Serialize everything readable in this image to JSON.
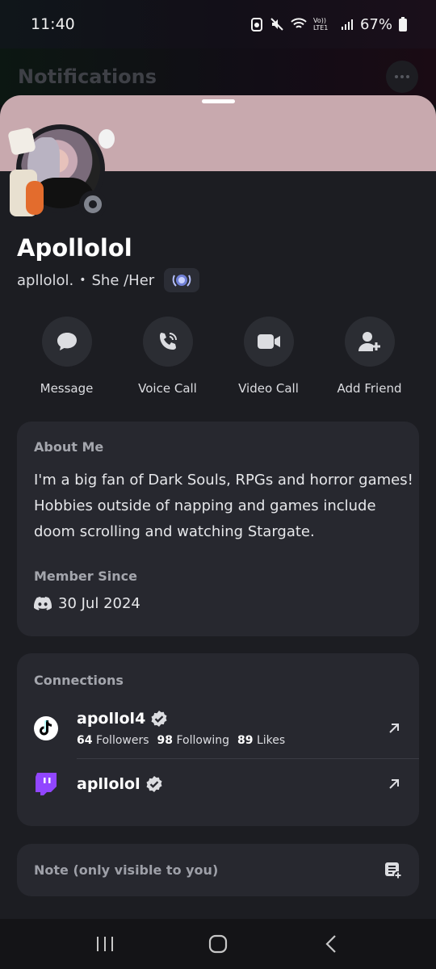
{
  "status_bar": {
    "time": "11:40",
    "network": "Vo)) LTE1",
    "battery_percent": "67%"
  },
  "background": {
    "title": "Notifications"
  },
  "profile": {
    "display_name": "Apollolol",
    "username": "apllolol.",
    "pronouns": "She /Her",
    "banner_color": "#c8a9ae",
    "status": "offline"
  },
  "actions": [
    {
      "label": "Message",
      "icon": "chat-bubble-icon"
    },
    {
      "label": "Voice Call",
      "icon": "phone-call-icon"
    },
    {
      "label": "Video Call",
      "icon": "video-camera-icon"
    },
    {
      "label": "Add Friend",
      "icon": "add-friend-icon"
    }
  ],
  "about": {
    "title": "About Me",
    "text": "I'm a big fan of Dark Souls, RPGs and horror games! Hobbies outside of napping and games include doom scrolling and watching Stargate.",
    "member_since_title": "Member Since",
    "member_since_date": "30 Jul 2024"
  },
  "connections": {
    "title": "Connections",
    "items": [
      {
        "platform": "TikTok",
        "name": "apollol4",
        "verified": true,
        "followers": "64",
        "followers_label": "Followers",
        "following": "98",
        "following_label": "Following",
        "likes": "89",
        "likes_label": "Likes"
      },
      {
        "platform": "Twitch",
        "name": "apllolol",
        "verified": true
      }
    ]
  },
  "note": {
    "placeholder": "Note (only visible to you)"
  }
}
